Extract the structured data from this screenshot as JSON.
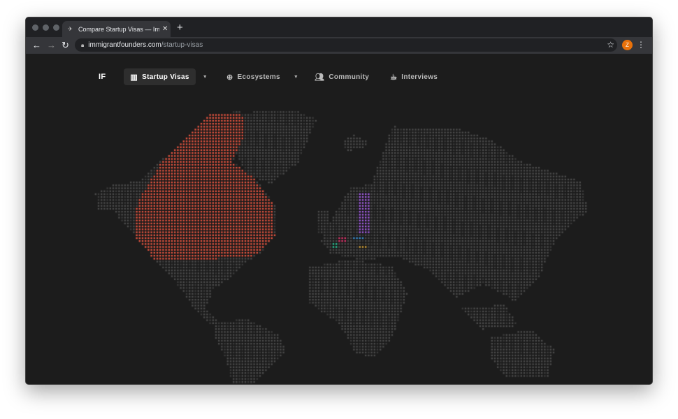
{
  "browser": {
    "tab_title": "Compare Startup Visas — Immigrant Founders",
    "url_host": "immigrantfounders.com",
    "url_path": "/startup-visas",
    "profile_initial": "Z"
  },
  "site_nav": {
    "logo": "IF",
    "items": [
      {
        "label": "Startup Visas",
        "icon": "map-icon",
        "active": true,
        "dropdown": true
      },
      {
        "label": "Ecosystems",
        "icon": "globe-icon",
        "dropdown": true
      },
      {
        "label": "Community",
        "icon": "users-icon"
      },
      {
        "label": "Interviews",
        "icon": "coffee-icon"
      }
    ]
  },
  "map": {
    "base_dot_color": "#4a4a4a",
    "highlights": [
      {
        "region": "Canada",
        "color": "#e0533f"
      },
      {
        "region": "Sweden",
        "color": "#a25ee0"
      },
      {
        "region": "Denmark",
        "color": "#3b8fd0"
      },
      {
        "region": "Netherlands",
        "color": "#d9366b"
      },
      {
        "region": "Germany",
        "color": "#d9366b"
      },
      {
        "region": "Austria",
        "color": "#d4a23a"
      },
      {
        "region": "France",
        "color": "#e05a7a"
      },
      {
        "region": "Spain",
        "color": "#2fc79a"
      }
    ]
  }
}
